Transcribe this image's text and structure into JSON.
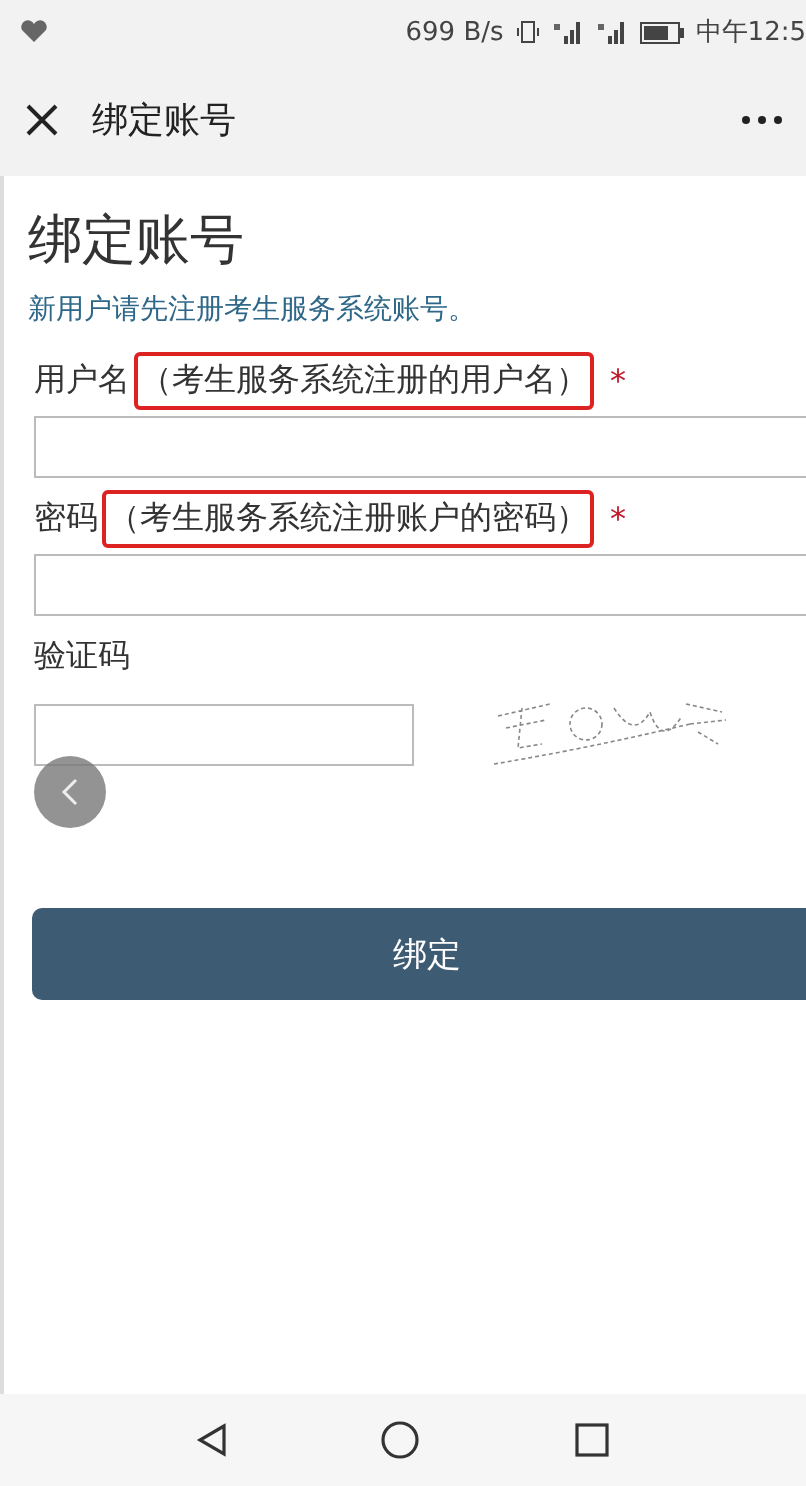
{
  "status_bar": {
    "speed": "699 B/s",
    "time": "中午12:5"
  },
  "nav": {
    "title": "绑定账号"
  },
  "page": {
    "heading": "绑定账号",
    "note": "新用户请先注册考生服务系统账号。"
  },
  "fields": [
    {
      "kind": "text",
      "label": "用户名",
      "annotation": "（考生服务系统注册的用户名）",
      "mark": "*"
    },
    {
      "kind": "password",
      "label": "密码",
      "annotation": "（考生服务系统注册账户的密码）",
      "mark": "*"
    },
    {
      "kind": "captcha",
      "label": "验证码"
    }
  ],
  "submit": "绑定"
}
